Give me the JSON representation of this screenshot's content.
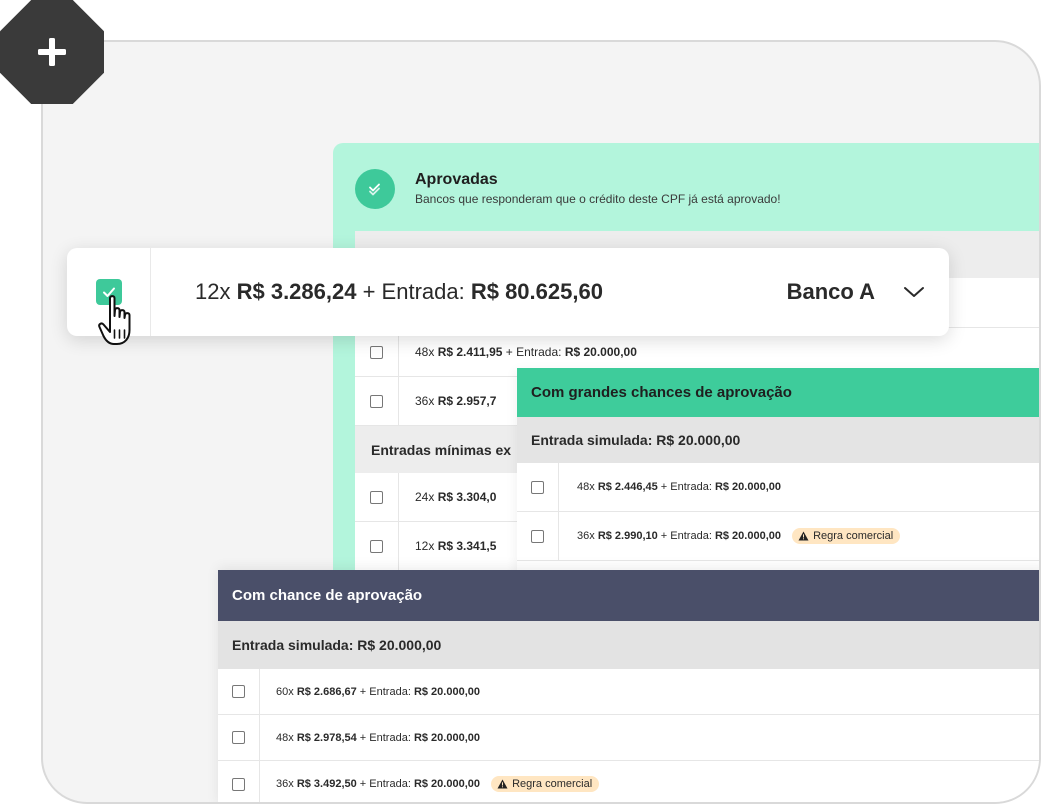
{
  "aprovadas": {
    "title": "Aprovadas",
    "subtitle": "Bancos que responderam que o crédito deste CPF já está aprovado!",
    "rows": [
      {
        "n": "48x",
        "amount": "R$ 2.411,95",
        "plus": " + Entrada: ",
        "entrada": "R$ 20.000,00"
      },
      {
        "n": "36x",
        "amount": "R$ 2.957,7",
        "plus": "",
        "entrada": ""
      }
    ],
    "section_label": "Entradas mínimas ex",
    "rows2": [
      {
        "n": "24x",
        "amount": "R$ 3.304,0",
        "plus": "",
        "entrada": ""
      },
      {
        "n": "12x",
        "amount": "R$ 3.341,5",
        "plus": "",
        "entrada": ""
      }
    ]
  },
  "floatbar": {
    "prefix": "12x ",
    "amount": "R$ 3.286,24",
    "plus": " + Entrada: ",
    "entrada": "R$ 80.625,60",
    "bank": "Banco A"
  },
  "grandes": {
    "title": "Com grandes chances de aprovação",
    "entrada_label": "Entrada simulada: R$ 20.000,00",
    "rows": [
      {
        "n": "48x",
        "amount": "R$ 2.446,45",
        "plus": " + Entrada: ",
        "entrada": "R$ 20.000,00",
        "warn": ""
      },
      {
        "n": "36x",
        "amount": "R$ 2.990,10",
        "plus": " + Entrada: ",
        "entrada": "R$ 20.000,00",
        "warn": "Regra comercial"
      }
    ]
  },
  "chance": {
    "title": "Com chance de aprovação",
    "entrada_label": "Entrada simulada: R$ 20.000,00",
    "rows": [
      {
        "n": "60x",
        "amount": "R$ 2.686,67",
        "plus": " + Entrada: ",
        "entrada": "R$ 20.000,00",
        "warn": ""
      },
      {
        "n": "48x",
        "amount": "R$ 2.978,54",
        "plus": " + Entrada: ",
        "entrada": "R$ 20.000,00",
        "warn": ""
      },
      {
        "n": "36x",
        "amount": "R$ 3.492,50",
        "plus": " + Entrada: ",
        "entrada": "R$ 20.000,00",
        "warn": "Regra comercial"
      }
    ]
  },
  "colors": {
    "mint": "#b3f5dc",
    "green": "#3ecc9b",
    "navy": "#4a4f69",
    "warn_bg": "#ffe6c2"
  },
  "icons": {
    "badge": "plus-icon",
    "aprovadas": "check-circle-icon",
    "float_checkbox": "checkbox-checked-icon",
    "cursor": "hand-pointer-icon",
    "expand": "chevron-down-icon",
    "warning": "warning-triangle-icon"
  }
}
